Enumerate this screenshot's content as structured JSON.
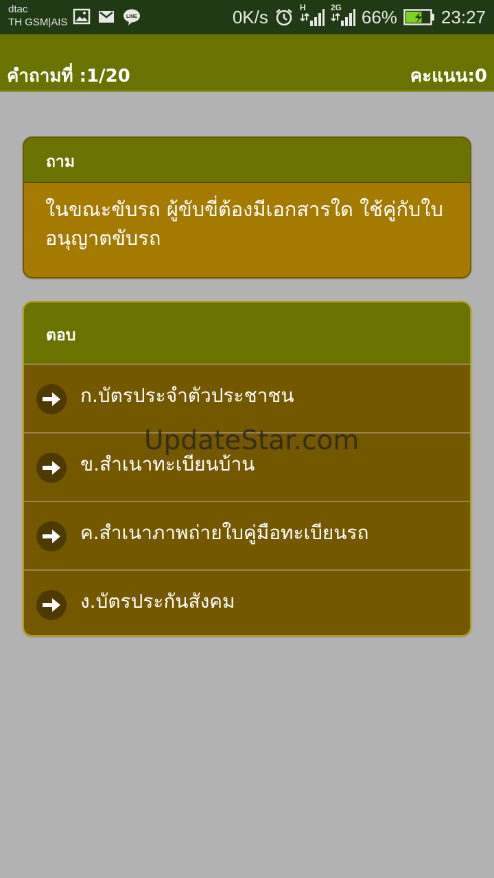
{
  "status_bar": {
    "carrier_line1": "dtac",
    "carrier_line2": "TH GSM|AIS",
    "net_speed": "0K/s",
    "net_type_1": "H",
    "net_type_2": "2G",
    "battery": "66%",
    "battery_level": 0.66,
    "time": "23:27",
    "notification_icons": [
      "image-icon",
      "gmail-icon",
      "line-icon"
    ]
  },
  "header": {
    "question_counter": "คำถามที่ :1/20",
    "score": "คะแนน:0"
  },
  "question": {
    "heading": "ถาม",
    "text": "ในขณะขับรถ ผู้ขับขี่ต้องมีเอกสารใด ใช้คู่กับใบอนุญาตขับรถ"
  },
  "answers": {
    "heading": "ตอบ",
    "choices": [
      {
        "label": "ก.บัตรประจำตัวประชาชน"
      },
      {
        "label": "ข.สำเนาทะเบียนบ้าน"
      },
      {
        "label": "ค.สำเนาภาพถ่ายใบคู่มือทะเบียนรถ"
      },
      {
        "label": "ง.บัตรประกันสังคม"
      }
    ]
  },
  "watermark": "UpdateStar.com",
  "colors": {
    "app_bar": "#6b7300",
    "question_body": "#a47b00",
    "answer_body": "#735800",
    "background": "#b2b2b2"
  }
}
